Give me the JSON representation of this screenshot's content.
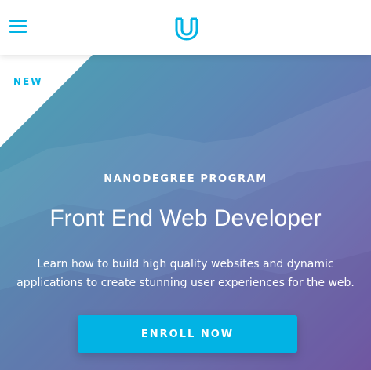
{
  "header": {
    "menu_icon": "hamburger-menu-icon",
    "logo_icon": "udacity-logo-icon",
    "accent_color": "#02b3e4"
  },
  "hero": {
    "ribbon_label": "NEW",
    "eyebrow": "NANODEGREE PROGRAM",
    "title": "Front End Web Developer",
    "description": "Learn how to build high quality websites and dynamic applications to create stunning user experiences for the web.",
    "cta_label": "ENROLL NOW",
    "gradient_colors": [
      "#4aa3b2",
      "#5b8ab6",
      "#6a72b2",
      "#7456a6"
    ]
  }
}
